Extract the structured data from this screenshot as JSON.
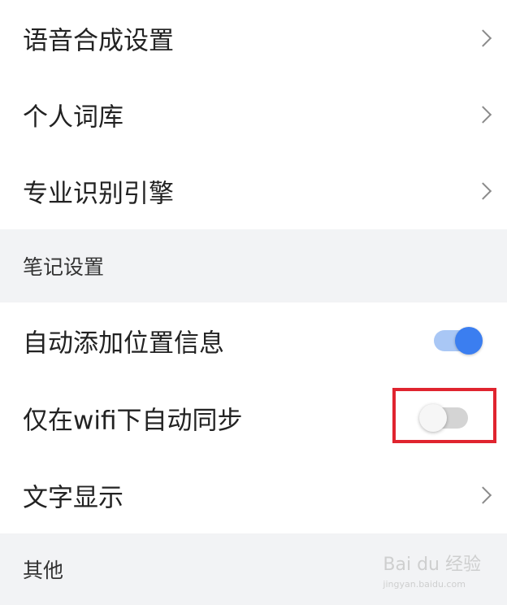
{
  "items": {
    "tts": {
      "label": "语音合成设置"
    },
    "dict": {
      "label": "个人词库"
    },
    "engine": {
      "label": "专业识别引擎"
    },
    "location": {
      "label": "自动添加位置信息",
      "enabled": true
    },
    "wifi_sync": {
      "label": "仅在wifi下自动同步",
      "enabled": false
    },
    "text_display": {
      "label": "文字显示"
    }
  },
  "sections": {
    "notes": {
      "label": "笔记设置"
    },
    "other": {
      "label": "其他"
    }
  },
  "watermark": {
    "text": "Bai du 经验",
    "sub": "jingyan.baidu.com"
  },
  "colors": {
    "accent": "#3b7ef0",
    "highlight": "#e0242f",
    "section_bg": "#f2f3f5"
  }
}
